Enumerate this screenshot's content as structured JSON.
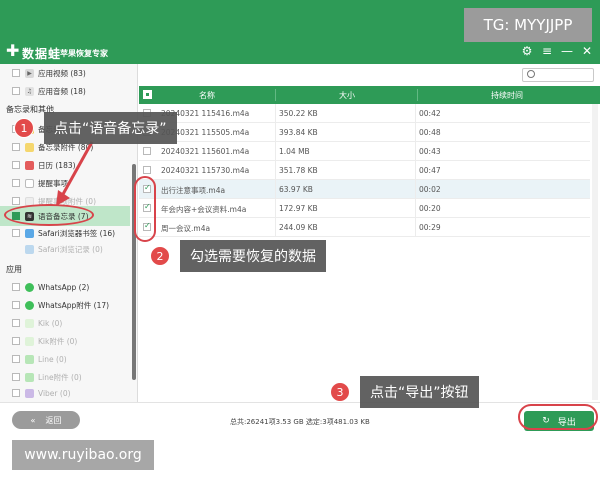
{
  "app": {
    "name": "数据蛙",
    "subtitle": "苹果恢复专家"
  },
  "window_controls": [
    "⚙",
    "≡",
    "—",
    "✕"
  ],
  "sidebar": {
    "group_top": [
      {
        "label": "应用视频 (83)",
        "icon": "video-app-icon",
        "dim": false
      },
      {
        "label": "应用音频 (18)",
        "icon": "music-app-icon",
        "dim": false
      }
    ],
    "section1": "备忘录和其他",
    "memo_items": [
      {
        "label": "备忘录",
        "icon": "note-icon",
        "dim": false
      },
      {
        "label": "备忘录附件 (80)",
        "icon": "attachment-icon",
        "dim": false
      },
      {
        "label": "日历 (183)",
        "icon": "calendar-icon",
        "dim": false
      },
      {
        "label": "提醒事项",
        "icon": "reminder-icon",
        "dim": false
      },
      {
        "label": "提醒事项附件 (0)",
        "icon": "reminder-attachment-icon",
        "dim": true
      },
      {
        "label": "语音备忘录 (7)",
        "icon": "voice-memo-icon",
        "dim": false,
        "selected": true
      },
      {
        "label": "Safari浏览器书签 (16)",
        "icon": "safari-bookmark-icon",
        "dim": false
      },
      {
        "label": "Safari浏览记录 (0)",
        "icon": "safari-history-icon",
        "dim": true
      }
    ],
    "section2": "应用",
    "app_items": [
      {
        "label": "WhatsApp (2)",
        "icon": "whatsapp-icon",
        "dim": false
      },
      {
        "label": "WhatsApp附件 (17)",
        "icon": "whatsapp-attachment-icon",
        "dim": false
      },
      {
        "label": "Kik (0)",
        "icon": "kik-icon",
        "dim": true
      },
      {
        "label": "Kik附件 (0)",
        "icon": "kik-attachment-icon",
        "dim": true
      },
      {
        "label": "Line (0)",
        "icon": "line-icon",
        "dim": true
      },
      {
        "label": "Line附件 (0)",
        "icon": "line-attachment-icon",
        "dim": true
      },
      {
        "label": "Viber (0)",
        "icon": "viber-icon",
        "dim": true
      },
      {
        "label": "Viber...",
        "icon": "viber-attachment-icon",
        "dim": true
      }
    ]
  },
  "table": {
    "headers": {
      "name": "名称",
      "size": "大小",
      "duration": "持续时间"
    },
    "rows": [
      {
        "name": "20240321 115416.m4a",
        "size": "350.22 KB",
        "duration": "00:42",
        "checked": false
      },
      {
        "name": "20240321 115505.m4a",
        "size": "393.84 KB",
        "duration": "00:48",
        "checked": false
      },
      {
        "name": "20240321 115601.m4a",
        "size": "1.04 MB",
        "duration": "00:43",
        "checked": false
      },
      {
        "name": "20240321 115730.m4a",
        "size": "351.78 KB",
        "duration": "00:47",
        "checked": false
      },
      {
        "name": "出行注意事项.m4a",
        "size": "63.97 KB",
        "duration": "00:02",
        "checked": true
      },
      {
        "name": "年会内容+会议资料.m4a",
        "size": "172.97 KB",
        "duration": "00:20",
        "checked": true
      },
      {
        "name": "周一会议.m4a",
        "size": "244.09 KB",
        "duration": "00:29",
        "checked": true
      }
    ]
  },
  "bottom": {
    "back_label": "返回",
    "back_icon": "«",
    "summary": "总共:26241项3.53 GB 选定:3项481.03 KB",
    "export_label": "导出",
    "export_icon": "↻"
  },
  "annotations": {
    "step1": {
      "num": "1",
      "text": "点击“语音备忘录”"
    },
    "step2": {
      "num": "2",
      "text": "勾选需要恢复的数据"
    },
    "step3": {
      "num": "3",
      "text": "点击“导出”按钮"
    }
  },
  "watermarks": {
    "tg": "TG: MYYJJPP",
    "site": "www.ruyibao.org"
  },
  "colors": {
    "brand_green": "#2e9b57",
    "annotation_red": "#d8434a",
    "selected_row": "#bfe6c9"
  }
}
